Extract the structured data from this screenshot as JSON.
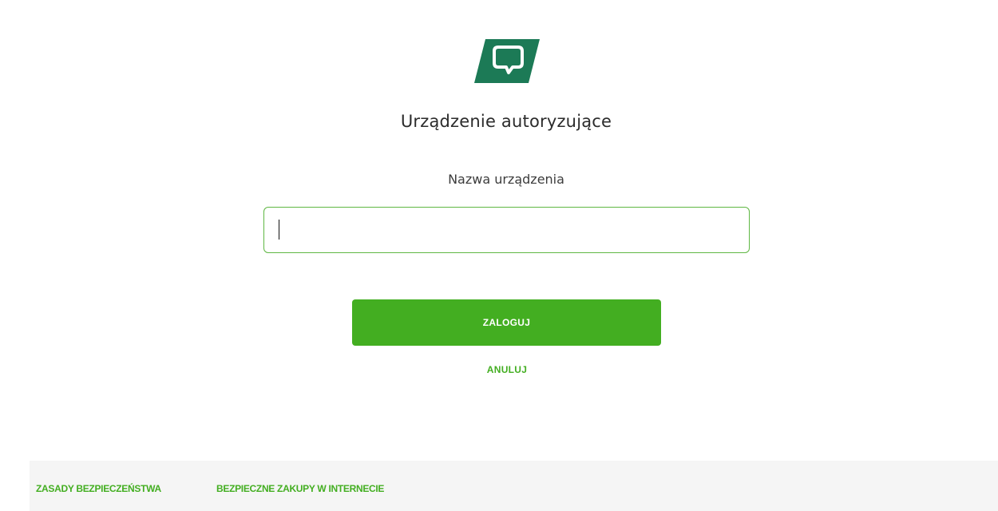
{
  "brand": {
    "logo_icon": "bank-logo-icon",
    "primary_color": "#1c7a56",
    "accent_color": "#43ae21"
  },
  "main": {
    "title": "Urządzenie autoryzujące",
    "field_label": "Nazwa urządzenia",
    "device_name_value": "",
    "login_button_label": "ZALOGUJ",
    "cancel_link_label": "ANULUJ"
  },
  "footer": {
    "links": [
      {
        "label": "ZASADY BEZPIECZEŃSTWA"
      },
      {
        "label": "BEZPIECZNE ZAKUPY W INTERNECIE"
      }
    ]
  }
}
